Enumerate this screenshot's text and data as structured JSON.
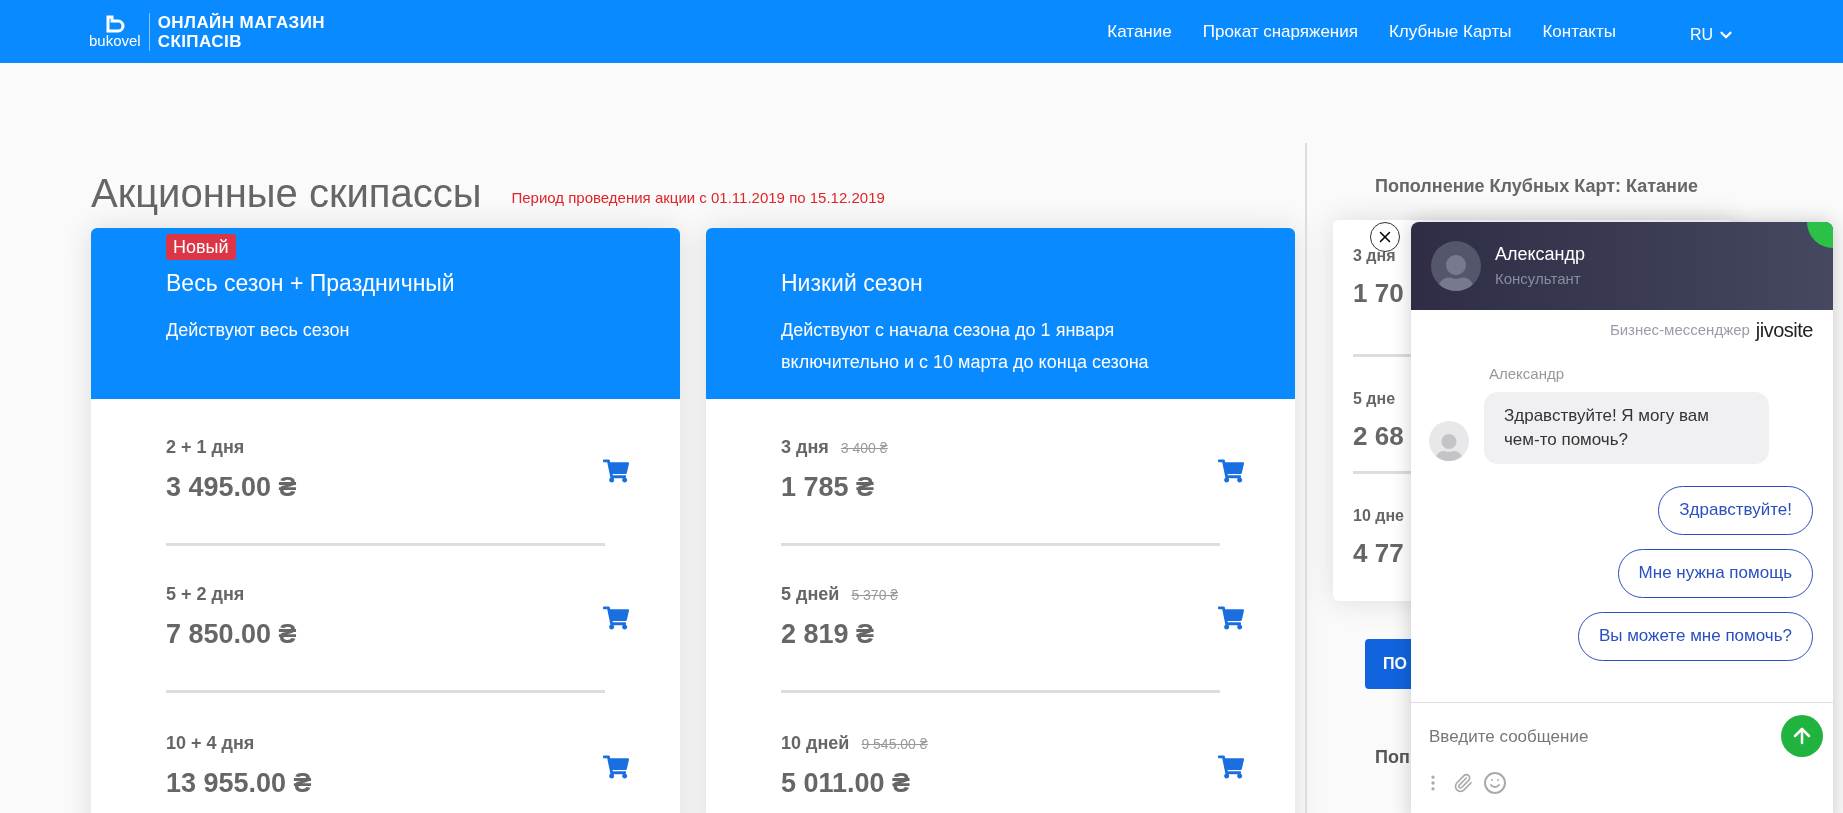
{
  "header": {
    "logo_text": "bukovel",
    "store_title": [
      "ОНЛАЙН МАГАЗИН",
      "СКІПАСІВ"
    ],
    "nav": [
      "Катание",
      "Прокат снаряжения",
      "Клубные Карты",
      "Контакты"
    ],
    "language": "RU"
  },
  "page": {
    "title": "Акционные скипассы",
    "promo_period": "Период проведения акции с 01.11.2019 по 15.12.2019"
  },
  "cards": [
    {
      "badge": "Новый",
      "title": "Весь сезон + Праздничный",
      "description": "Действуют весь сезон",
      "items": [
        {
          "label": "2 + 1 дня",
          "price": "3 495.00 ₴"
        },
        {
          "label": "5 + 2 дня",
          "price": "7 850.00 ₴"
        },
        {
          "label": "10 + 4 дня",
          "price": "13 955.00 ₴"
        }
      ]
    },
    {
      "title": "Низкий сезон",
      "description": "Действуют с начала сезона до 1 января включительно и с 10 марта до конца сезона",
      "items": [
        {
          "label": "3 дня",
          "old_price": "3 400 ₴",
          "price": "1 785 ₴"
        },
        {
          "label": "5 дней",
          "old_price": "5 370 ₴",
          "price": "2 819 ₴"
        },
        {
          "label": "10 дней",
          "old_price": "9 545.00 ₴",
          "price": "5 011.00 ₴"
        }
      ]
    }
  ],
  "side": {
    "title": "Пополнение Клубных Карт: Катание",
    "items": [
      {
        "label": "3 дня",
        "price": "1 70"
      },
      {
        "label": "5 дне",
        "price": "2 68"
      },
      {
        "label": "10 дне",
        "price": "4 77"
      }
    ],
    "button_label": "ПО",
    "footer_label": "Поп"
  },
  "chat": {
    "agent_name": "Александр",
    "agent_role": "Консультант",
    "branding": "Бизнес-мессенджер",
    "brand": "jivosite",
    "sender": "Александр",
    "message": "Здравствуйте! Я могу вам чем-то помочь?",
    "quick_replies": [
      "Здравствуйте!",
      "Мне нужна помощь",
      "Вы можете мне помочь?"
    ],
    "input_placeholder": "Введите сообщение"
  }
}
